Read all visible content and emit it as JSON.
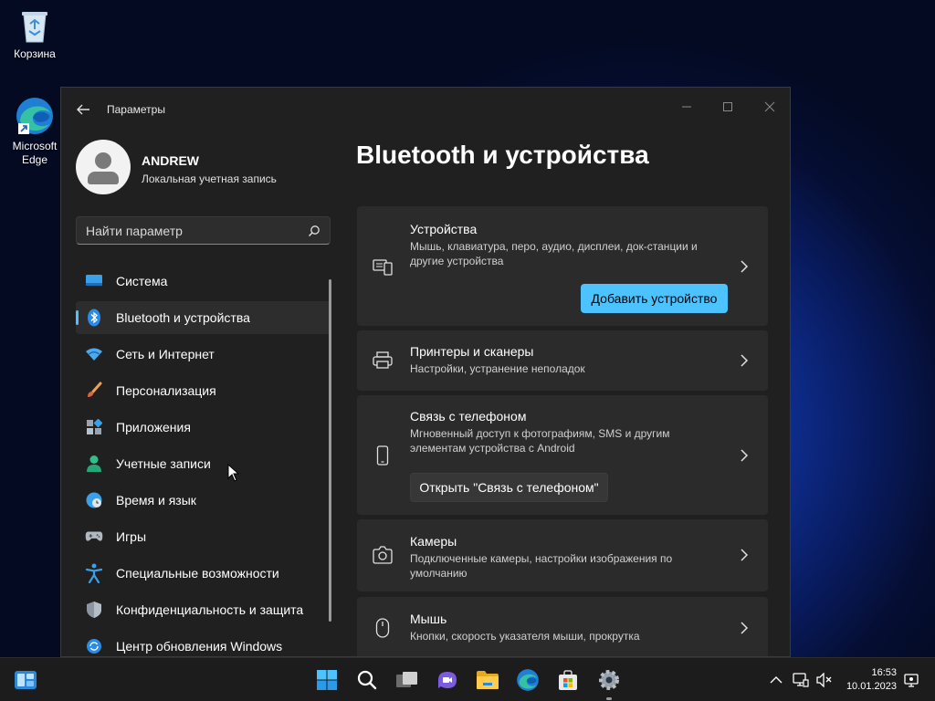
{
  "desktop": {
    "icons": [
      {
        "label": "Корзина",
        "icon": "recycle-bin-icon"
      },
      {
        "label": "Microsoft Edge",
        "icon": "edge-icon"
      }
    ]
  },
  "window": {
    "title": "Параметры",
    "controls": [
      "minimize",
      "maximize",
      "close"
    ]
  },
  "profile": {
    "name": "ANDREW",
    "account_type": "Локальная учетная запись"
  },
  "search": {
    "placeholder": "Найти параметр"
  },
  "nav": {
    "items": [
      {
        "label": "Система",
        "icon": "system-icon",
        "active": false
      },
      {
        "label": "Bluetooth и устройства",
        "icon": "bluetooth-icon",
        "active": true
      },
      {
        "label": "Сеть и Интернет",
        "icon": "wifi-icon",
        "active": false
      },
      {
        "label": "Персонализация",
        "icon": "brush-icon",
        "active": false
      },
      {
        "label": "Приложения",
        "icon": "apps-icon",
        "active": false
      },
      {
        "label": "Учетные записи",
        "icon": "account-icon",
        "active": false
      },
      {
        "label": "Время и язык",
        "icon": "clock-globe-icon",
        "active": false
      },
      {
        "label": "Игры",
        "icon": "gamepad-icon",
        "active": false
      },
      {
        "label": "Специальные возможности",
        "icon": "accessibility-icon",
        "active": false
      },
      {
        "label": "Конфиденциальность и защита",
        "icon": "shield-icon",
        "active": false
      },
      {
        "label": "Центр обновления Windows",
        "icon": "update-icon",
        "active": false
      }
    ]
  },
  "main": {
    "title": "Bluetooth и устройства",
    "cards": [
      {
        "title": "Устройства",
        "desc": "Мышь, клавиатура, перо, аудио, дисплеи, док-станции и другие устройства",
        "icon": "devices-icon",
        "button": "Добавить устройство"
      },
      {
        "title": "Принтеры и сканеры",
        "desc": "Настройки, устранение неполадок",
        "icon": "printer-icon"
      },
      {
        "title": "Связь с телефоном",
        "desc": "Мгновенный доступ к фотографиям, SMS и другим элементам устройства с Android",
        "icon": "phone-icon",
        "button": "Открыть \"Связь с телефоном\""
      },
      {
        "title": "Камеры",
        "desc": "Подключенные камеры, настройки изображения по умолчанию",
        "icon": "camera-icon"
      },
      {
        "title": "Мышь",
        "desc": "Кнопки, скорость указателя мыши, прокрутка",
        "icon": "mouse-icon"
      }
    ]
  },
  "taskbar": {
    "apps": [
      "widgets-icon",
      "start-icon",
      "search-icon",
      "task-view-icon",
      "chat-icon",
      "file-explorer-icon",
      "edge-icon",
      "store-icon",
      "settings-icon"
    ],
    "tray": [
      "chevron-up-icon",
      "network-icon",
      "volume-muted-icon",
      "notification-icon"
    ],
    "time": "16:53",
    "date": "10.01.2023"
  },
  "colors": {
    "accent": "#4cc2ff",
    "window_bg": "#202020",
    "card_bg": "#2b2b2b",
    "taskbar_bg": "#1c1c1c"
  }
}
